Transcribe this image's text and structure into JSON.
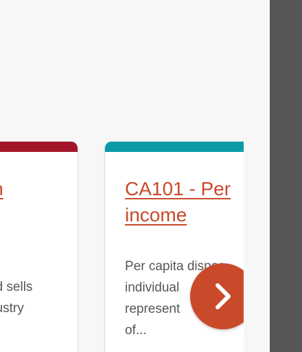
{
  "cards": [
    {
      "title": "in",
      "description": "nd sells\ndustry",
      "accent_color": "#a3162a"
    },
    {
      "title": "CA101 - Per\nincome",
      "description": "Per capita dispos\nindividual\nrepresent\nof...",
      "accent_color": "#0a9aa7"
    }
  ],
  "carousel": {
    "next_icon": "chevron-right-icon",
    "button_color": "#c94a2a"
  },
  "colors": {
    "link": "#c94a2a",
    "side_panel": "#575757",
    "background": "#f7f7f7"
  }
}
